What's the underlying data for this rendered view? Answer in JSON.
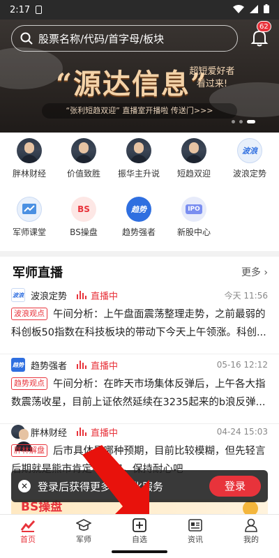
{
  "status_bar": {
    "time": "2:17",
    "sim_icon": "sim-icon",
    "wifi": "wifi-icon",
    "signal": "signal-icon",
    "battery": "battery-icon"
  },
  "search": {
    "placeholder": "股票名称/代码/首字母/板块"
  },
  "notifications": {
    "count": "62"
  },
  "banner": {
    "title": "“源达信息”",
    "tagline_1": "超短爱好者",
    "tagline_2": "看过来!",
    "subtitle": "“张利短趋双迎”  直播室开播啦 传送门>>>"
  },
  "grid": [
    {
      "label": "胖林财经",
      "icon": "avatar"
    },
    {
      "label": "价值致胜",
      "icon": "avatar"
    },
    {
      "label": "振华主升说",
      "icon": "avatar"
    },
    {
      "label": "短趋双迎",
      "icon": "avatar"
    },
    {
      "label": "波浪定势",
      "icon": "波浪"
    },
    {
      "label": "军师课堂",
      "icon": "chart-icon"
    },
    {
      "label": "BS操盘",
      "icon": "BS"
    },
    {
      "label": "趋势强者",
      "icon": "趋势"
    },
    {
      "label": "新股中心",
      "icon": "IPO"
    }
  ],
  "live": {
    "title": "军师直播",
    "more": "更多",
    "cards": [
      {
        "author": "波浪定势",
        "avatar_text": "波浪",
        "status": "直播中",
        "time": "今天 11:56",
        "tag": "波浪观点",
        "text_1": "午间分析：上午盘面震荡整理走势，之前最弱的",
        "text_2": "科创板50指数在科技板块的带动下今天上午领涨。科创..."
      },
      {
        "author": "趋势强者",
        "avatar_text": "趋势",
        "status": "直播中",
        "time": "05-16 12:12",
        "tag": "趋势观点",
        "text_1": "午间分析：在昨天市场集体反弹后，上午各大指",
        "text_2": "数震荡收星，目前上证依然延续在3235起来的b浪反弹..."
      },
      {
        "author": "胖林财经",
        "avatar_text": "",
        "status": "直播中",
        "time": "04-24 15:03",
        "tag": "胖林解盘",
        "text_1": "后市具体是哪种预期，目前比较模糊，但先轻言",
        "text_2": "后期就是熊市肯定不可取，保持耐心吧"
      }
    ]
  },
  "toast": {
    "message": "登录后获得更多个性化服务",
    "button": "登录"
  },
  "peek": {
    "text": "BS操盘"
  },
  "tabs": [
    {
      "label": "首页",
      "icon": "home-icon"
    },
    {
      "label": "军师",
      "icon": "graduation-cap-icon"
    },
    {
      "label": "自选",
      "icon": "plus-square-icon"
    },
    {
      "label": "资讯",
      "icon": "news-icon"
    },
    {
      "label": "我的",
      "icon": "user-icon"
    }
  ],
  "colors": {
    "accent": "#e8333b",
    "banner_gold": "#f3d2a8"
  }
}
